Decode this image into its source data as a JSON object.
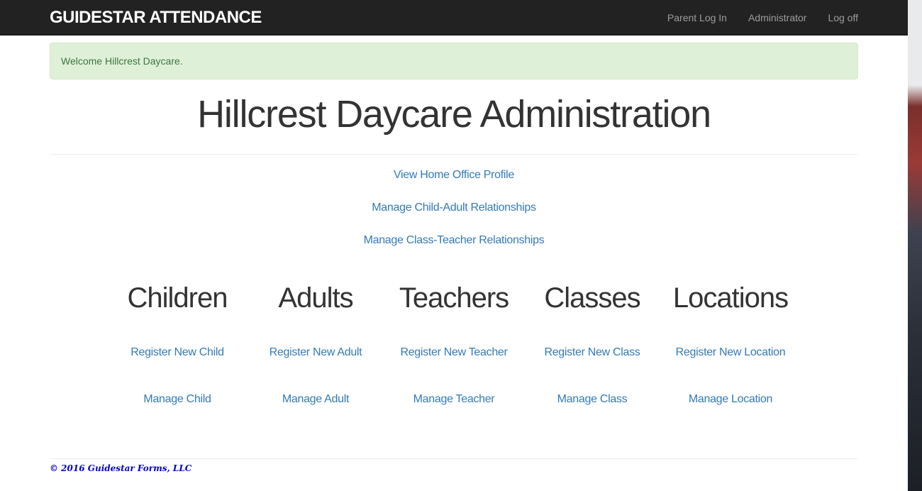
{
  "navbar": {
    "brand": "GUIDESTAR ATTENDANCE",
    "links": [
      "Parent Log In",
      "Administrator",
      "Log off"
    ]
  },
  "alert": {
    "message": "Welcome Hillcrest Daycare."
  },
  "page_title": "Hillcrest Daycare Administration",
  "top_links": [
    "View Home Office Profile",
    "Manage Child-Adult Relationships",
    "Manage Class-Teacher Relationships"
  ],
  "sections": [
    {
      "heading": "Children",
      "register": "Register New Child",
      "manage": "Manage Child"
    },
    {
      "heading": "Adults",
      "register": "Register New Adult",
      "manage": "Manage Adult"
    },
    {
      "heading": "Teachers",
      "register": "Register New Teacher",
      "manage": "Manage Teacher"
    },
    {
      "heading": "Classes",
      "register": "Register New Class",
      "manage": "Manage Class"
    },
    {
      "heading": "Locations",
      "register": "Register New Location",
      "manage": "Manage Location"
    }
  ],
  "footer": {
    "copyright": "© 2016 Guidestar Forms, LLC"
  },
  "colors": {
    "navbar_bg": "#222222",
    "link": "#337ab7",
    "alert_bg": "#dff0d8",
    "alert_text": "#3c763d",
    "footer_text": "#0000cc"
  }
}
